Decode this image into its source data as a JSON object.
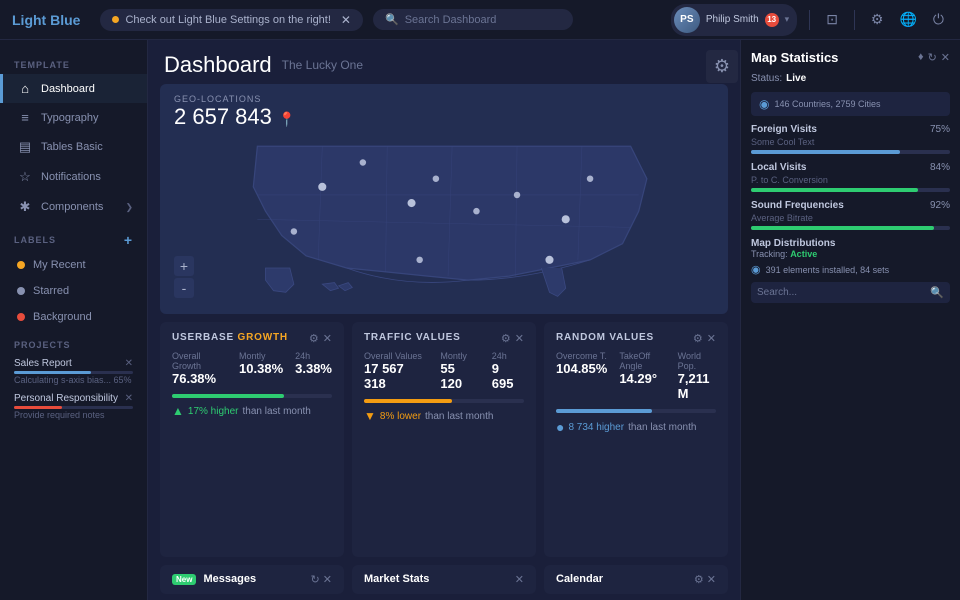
{
  "app": {
    "logo_light": "Light",
    "logo_bold": "Blue"
  },
  "topnav": {
    "tab_label": "Check out Light Blue Settings on the right!",
    "search_placeholder": "Search Dashboard",
    "user_name": "Philip Smith",
    "user_initials": "PS",
    "badge_count": "13"
  },
  "sidebar": {
    "nav_items": [
      {
        "label": "Dashboard",
        "icon": "⌂",
        "active": true
      },
      {
        "label": "Typography",
        "icon": "≡",
        "active": false
      },
      {
        "label": "Tables Basic",
        "icon": "▤",
        "active": false
      },
      {
        "label": "Notifications",
        "icon": "☆",
        "active": false
      },
      {
        "label": "Components",
        "icon": "✱",
        "active": false,
        "arrow": true
      }
    ],
    "template_section": "TEMPLATE",
    "labels_section": "LABELS",
    "labels": [
      {
        "label": "My Recent",
        "color": "#f5a623"
      },
      {
        "label": "Starred",
        "color": "#8891b0"
      },
      {
        "label": "Background",
        "color": "#e74c3c"
      }
    ],
    "projects_section": "PROJECTS",
    "projects": [
      {
        "name": "Sales Report",
        "progress": 65,
        "bar_color": "#5b9bd5",
        "sub": "Calculating s-axis bias... 65%",
        "show_x": true
      },
      {
        "name": "Personal Responsibility",
        "progress": 40,
        "bar_color": "#e74c3c",
        "sub": "Provide required notes",
        "show_x": true
      }
    ]
  },
  "main": {
    "page_title": "Dashboard",
    "page_subtitle": "The Lucky One",
    "map": {
      "geo_label": "GEO-LOCATIONS",
      "geo_count": "2 657 843",
      "zoom_plus": "+",
      "zoom_minus": "-"
    },
    "cards": [
      {
        "id": "userbase",
        "title": "USERBASE GROWTH",
        "highlight": "H",
        "stats": [
          {
            "label": "Overall Growth",
            "value": "76.38%"
          },
          {
            "label": "Montly",
            "value": "10.38%"
          },
          {
            "label": "24h",
            "value": "3.38%"
          }
        ],
        "bar_color": "#2ecc71",
        "bar_pct": 70,
        "trend": "17% higher",
        "trend_type": "up",
        "trend_text": "than last month"
      },
      {
        "id": "traffic",
        "title": "TRAFFIC VALUES",
        "highlight": "",
        "stats": [
          {
            "label": "Overall Values",
            "value": "17 567 318"
          },
          {
            "label": "Montly",
            "value": "55 120"
          },
          {
            "label": "24h",
            "value": "9 695"
          }
        ],
        "bar_color": "#f39c12",
        "bar_pct": 55,
        "trend": "8% lower",
        "trend_type": "down",
        "trend_text": "than last month"
      },
      {
        "id": "random",
        "title": "RANDOM VALUES",
        "highlight": "",
        "stats": [
          {
            "label": "Overcome T.",
            "value": "104.85%"
          },
          {
            "label": "TakeOff Angle",
            "value": "14.29°"
          },
          {
            "label": "World Pop.",
            "value": "7,211 M"
          }
        ],
        "bar_color": "#5b9bd5",
        "bar_pct": 60,
        "trend": "8 734 higher",
        "trend_type": "blue",
        "trend_text": "than last month"
      }
    ],
    "bottom_cards": [
      {
        "id": "messages",
        "badge": "New",
        "title": "Messages",
        "is_new": true
      },
      {
        "id": "market",
        "title": "Market Stats",
        "is_new": false
      },
      {
        "id": "calendar",
        "title": "Calendar",
        "is_new": false
      }
    ]
  },
  "right_panel": {
    "title": "Map Statistics",
    "status_label": "Status:",
    "status_value": "Live",
    "countries_text": "146 Countries, 2759 Cities",
    "stats": [
      {
        "title": "Foreign Visits",
        "sub": "Some Cool Text",
        "pct": "75%",
        "pct_num": 75,
        "bar_color": "#5b9bd5"
      },
      {
        "title": "Local Visits",
        "sub": "P. to C. Conversion",
        "pct": "84%",
        "pct_num": 84,
        "bar_color": "#2ecc71"
      },
      {
        "title": "Sound Frequencies",
        "sub": "Average Bitrate",
        "pct": "92%",
        "pct_num": 92,
        "bar_color": "#2ecc71"
      }
    ],
    "distributions_title": "Map Distributions",
    "distributions_sub": "Tracking: Active",
    "distributions_detail": "391 elements installed, 84 sets",
    "search_placeholder": "Search..."
  }
}
